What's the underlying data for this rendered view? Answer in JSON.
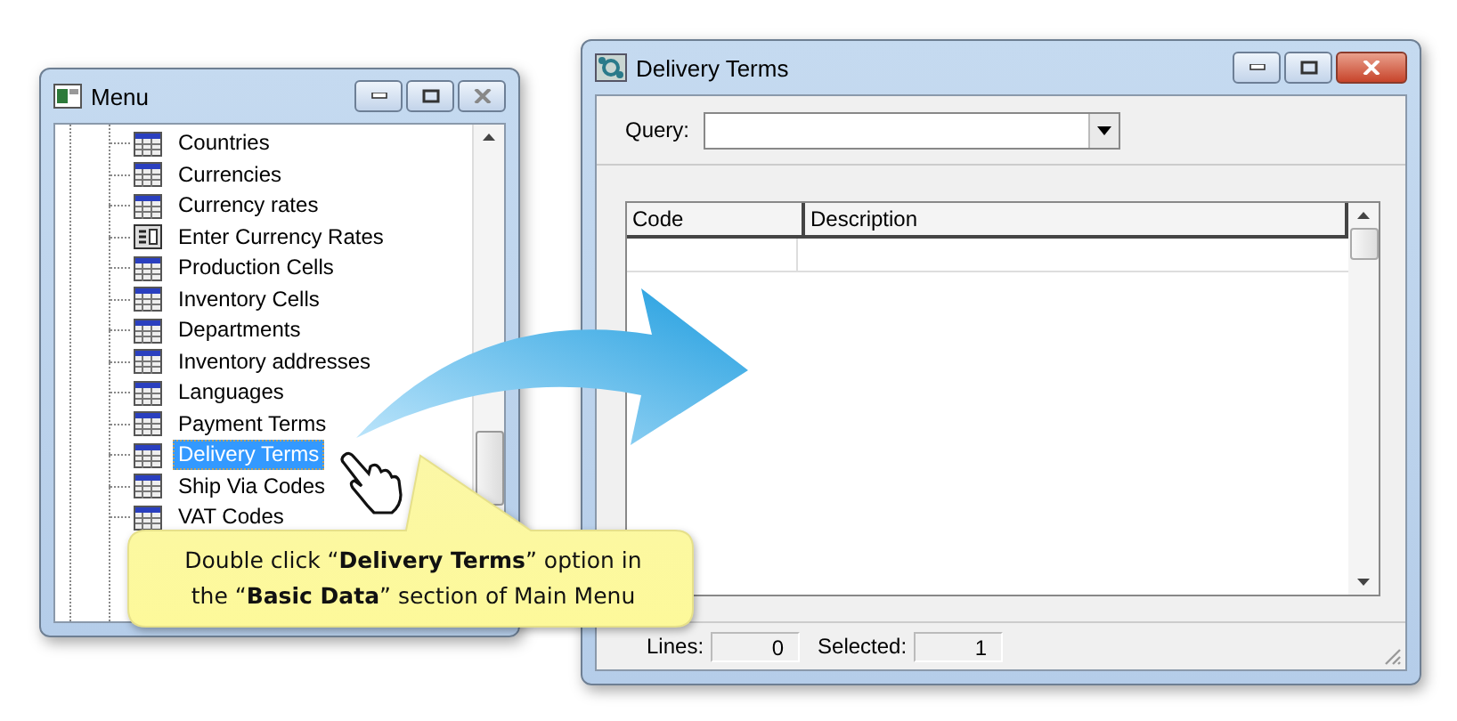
{
  "menu_window": {
    "title": "Menu",
    "items": [
      {
        "label": "Countries",
        "kind": "table",
        "selected": false
      },
      {
        "label": "Currencies",
        "kind": "table",
        "selected": false
      },
      {
        "label": "Currency rates",
        "kind": "table",
        "selected": false
      },
      {
        "label": "Enter Currency Rates",
        "kind": "form",
        "selected": false
      },
      {
        "label": "Production Cells",
        "kind": "table",
        "selected": false
      },
      {
        "label": "Inventory Cells",
        "kind": "table",
        "selected": false
      },
      {
        "label": "Departments",
        "kind": "table",
        "selected": false
      },
      {
        "label": "Inventory addresses",
        "kind": "table",
        "selected": false
      },
      {
        "label": "Languages",
        "kind": "table",
        "selected": false
      },
      {
        "label": "Payment Terms",
        "kind": "table",
        "selected": false
      },
      {
        "label": "Delivery Terms",
        "kind": "table",
        "selected": true
      },
      {
        "label": "Ship Via Codes",
        "kind": "table",
        "selected": false
      },
      {
        "label": "VAT Codes",
        "kind": "table",
        "selected": false
      }
    ]
  },
  "delivery_window": {
    "title": "Delivery Terms",
    "query": {
      "label": "Query:"
    },
    "grid": {
      "columns": [
        "Code",
        "Description"
      ]
    },
    "status": [
      {
        "label": "Lines:",
        "value": "0"
      },
      {
        "label": "Selected:",
        "value": "1"
      }
    ]
  },
  "callout": {
    "text": "Double click “**Delivery Terms**” option in the “**Basic Data**” section of Main Menu"
  }
}
